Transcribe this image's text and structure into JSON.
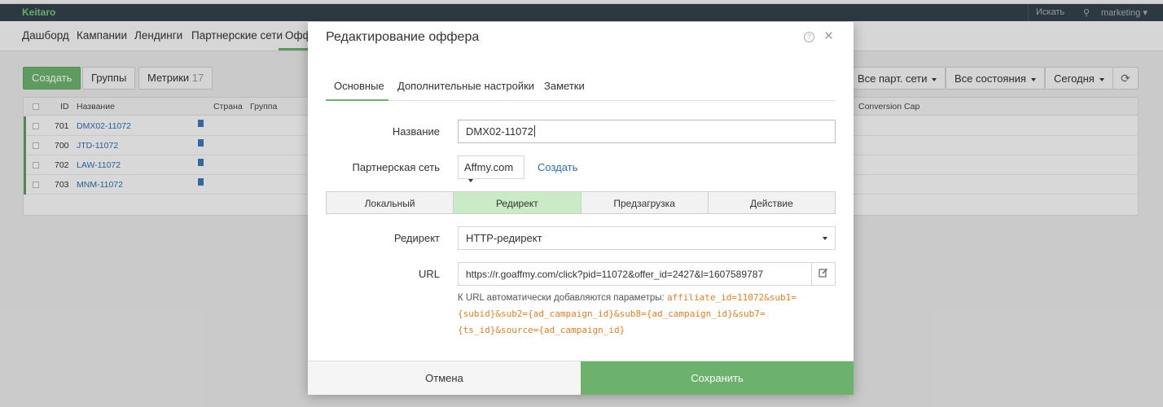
{
  "app": {
    "logo": "Keitaro",
    "search_label": "Искать",
    "user_label": "marketing",
    "nav": [
      "Дашборд",
      "Кампании",
      "Лендинги",
      "Партнерские сети",
      "Офф"
    ]
  },
  "toolbar": {
    "create_label": "Создать",
    "groups_label": "Группы",
    "metrics_label": "Метрики",
    "metrics_count": "17",
    "filters": [
      "Все парт. сети",
      "Все состояния",
      "Сегодня"
    ]
  },
  "grid": {
    "columns": {
      "id": "ID",
      "name": "Название",
      "country": "Страна",
      "group": "Группа",
      "conversion_cap": "Conversion Cap"
    },
    "rows": [
      {
        "id": "701",
        "name": "DMX02-11072"
      },
      {
        "id": "700",
        "name": "JTD-11072"
      },
      {
        "id": "702",
        "name": "LAW-11072"
      },
      {
        "id": "703",
        "name": "MNM-11072"
      }
    ]
  },
  "modal": {
    "title": "Редактирование оффера",
    "help_glyph": "?",
    "close_glyph": "×",
    "tabs": [
      "Основные",
      "Дополнительные настройки",
      "Заметки"
    ],
    "name_label": "Название",
    "name_value": "DMX02-11072",
    "affiliate_label": "Партнерская сеть",
    "affiliate_value": "Affmy.com",
    "affiliate_create_link": "Создать",
    "type_options": [
      "Локальный",
      "Редирект",
      "Предзагрузка",
      "Действие"
    ],
    "redirect_label": "Редирект",
    "redirect_value": "HTTP-редирект",
    "url_label": "URL",
    "url_value": "https://r.goaffmy.com/click?pid=11072&offer_id=2427&l=1607589787",
    "url_hint_text": "К URL автоматически добавляются параметры:",
    "url_hint_params": "affiliate_id=11072&sub1={subid}&sub2={ad_campaign_id}&sub8={ad_campaign_id}&sub7={ts_id}&source={ad_campaign_id}",
    "cancel_label": "Отмена",
    "save_label": "Сохранить"
  }
}
